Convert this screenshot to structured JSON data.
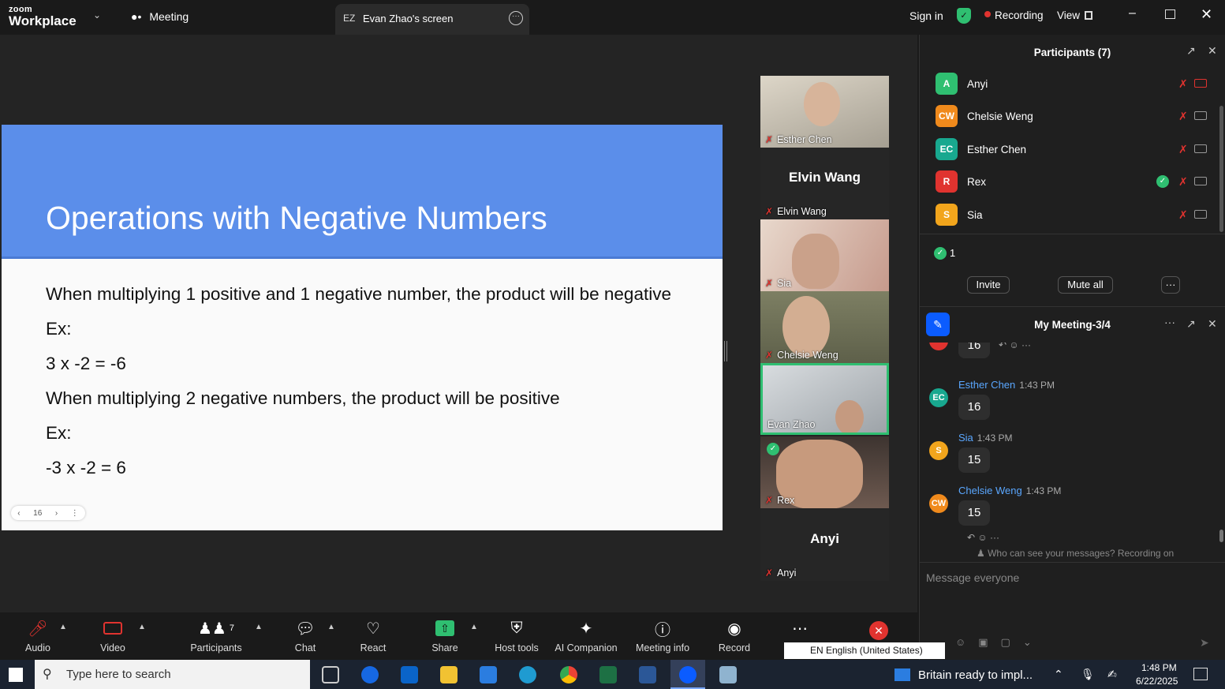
{
  "titlebar": {
    "logo_small": "zoom",
    "logo_big": "Workplace",
    "meeting_tab": "Meeting",
    "screen_tab_initials": "EZ",
    "screen_tab_label": "Evan Zhao's screen",
    "sign_in": "Sign in",
    "recording": "Recording",
    "view": "View"
  },
  "slide": {
    "title": "Operations with Negative Numbers",
    "lines": [
      "When multiplying 1 positive and 1 negative number, the product will be negative",
      "Ex:",
      "3 x -2 = -6",
      "When multiplying 2 negative numbers, the product will be positive",
      "Ex:",
      "-3 x -2 = 6"
    ],
    "page": "16"
  },
  "videos": [
    {
      "name": "Esther Chen",
      "big_name": "",
      "has_video": true,
      "color": "#c9c2b4"
    },
    {
      "name": "Elvin Wang",
      "big_name": "Elvin Wang",
      "has_video": false,
      "color": "#262626"
    },
    {
      "name": "Sia",
      "big_name": "",
      "has_video": true,
      "color": "#d9c3b4"
    },
    {
      "name": "Chelsie Weng",
      "big_name": "",
      "has_video": true,
      "color": "#8a8e6e"
    },
    {
      "name": "Evan Zhao",
      "big_name": "",
      "has_video": true,
      "color": "#b9bcc0"
    },
    {
      "name": "Rex",
      "big_name": "",
      "has_video": true,
      "color": "#5b4a42"
    },
    {
      "name": "Anyi",
      "big_name": "Anyi",
      "has_video": false,
      "color": "#262626"
    }
  ],
  "participants": {
    "title": "Participants (7)",
    "list": [
      {
        "initials": "A",
        "name": "Anyi",
        "color": "#2fbf71"
      },
      {
        "initials": "CW",
        "name": "Chelsie Weng",
        "color": "#f08a1c"
      },
      {
        "initials": "EC",
        "name": "Esther Chen",
        "color": "#18a88f"
      },
      {
        "initials": "R",
        "name": "Rex",
        "color": "#e0332f"
      },
      {
        "initials": "S",
        "name": "Sia",
        "color": "#f2a51c"
      }
    ],
    "yes_count": "1",
    "invite": "Invite",
    "mute_all": "Mute all"
  },
  "chat": {
    "title": "My Meeting-3/4",
    "top_value": "16",
    "messages": [
      {
        "initials": "EC",
        "sender": "Esther Chen",
        "time": "1:43 PM",
        "text": "16",
        "color": "#18a88f"
      },
      {
        "initials": "S",
        "sender": "Sia",
        "time": "1:43 PM",
        "text": "15",
        "color": "#f2a51c"
      },
      {
        "initials": "CW",
        "sender": "Chelsie Weng",
        "time": "1:43 PM",
        "text": "15",
        "color": "#f08a1c"
      }
    ],
    "notice": "Who can see your messages? Recording on",
    "placeholder": "Message everyone"
  },
  "toolbar": {
    "audio": "Audio",
    "video": "Video",
    "participants": "Participants",
    "participants_count": "7",
    "chat": "Chat",
    "react": "React",
    "share": "Share",
    "host_tools": "Host tools",
    "ai_companion": "AI Companion",
    "meeting_info": "Meeting info",
    "record": "Record",
    "language": "EN English (United States)"
  },
  "taskbar": {
    "search_placeholder": "Type here to search",
    "news": "Britain ready to impl...",
    "time": "1:48 PM",
    "date": "6/22/2025"
  },
  "colors": {
    "slide_header": "#5b8eea",
    "accent_blue": "#0b5cff",
    "record_red": "#e0332f",
    "active_green": "#2fbf71"
  }
}
